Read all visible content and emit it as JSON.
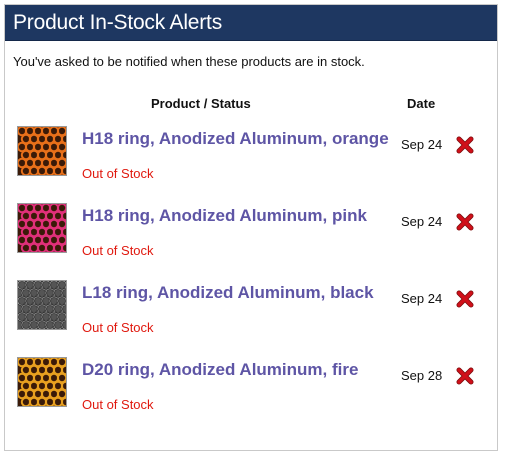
{
  "panel": {
    "title": "Product In-Stock Alerts",
    "intro": "You've asked to be notified when these products are in stock."
  },
  "columns": {
    "product_status": "Product / Status",
    "date": "Date"
  },
  "colors": {
    "title_bar": "#1e3761",
    "product_link": "#5e55a5",
    "out_of_stock": "#e0190f",
    "delete_icon": "#d0101a"
  },
  "alerts": [
    {
      "name": "H18 ring, Anodized Aluminum, orange",
      "status": "Out of Stock",
      "date": "Sep 24",
      "thumb_color": "#e8701a",
      "delete_icon": "red-x-icon"
    },
    {
      "name": "H18 ring, Anodized Aluminum, pink",
      "status": "Out of Stock",
      "date": "Sep 24",
      "thumb_color": "#e0307a",
      "delete_icon": "red-x-icon"
    },
    {
      "name": "L18 ring, Anodized Aluminum, black",
      "status": "Out of Stock",
      "date": "Sep 24",
      "thumb_color": "#2a2a2a",
      "delete_icon": "red-x-icon"
    },
    {
      "name": "D20 ring, Anodized Aluminum, fire",
      "status": "Out of Stock",
      "date": "Sep 28",
      "thumb_color": "#e8a020",
      "delete_icon": "red-x-icon"
    }
  ]
}
